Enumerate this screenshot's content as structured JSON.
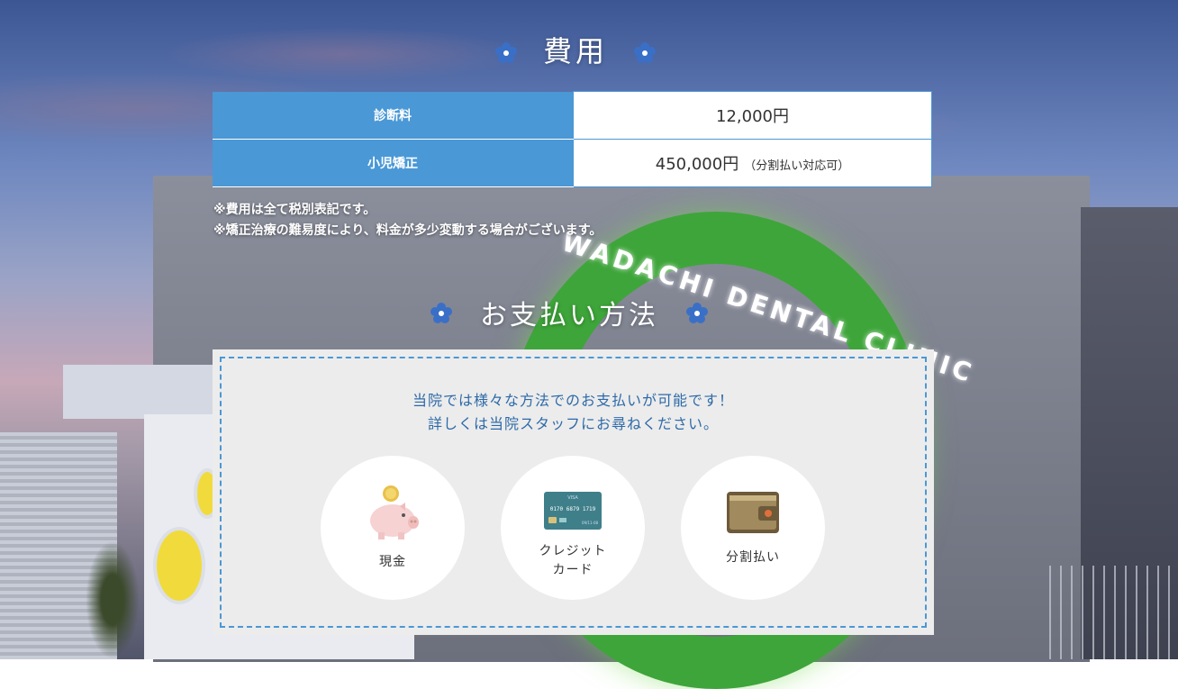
{
  "fees": {
    "title": "費用",
    "rows": [
      {
        "label": "診断料",
        "value": "12,000円",
        "note": ""
      },
      {
        "label": "小児矯正",
        "value": "450,000円",
        "note": "（分割払い対応可）"
      }
    ],
    "notes": [
      "※費用は全て税別表記です。",
      "※矯正治療の難易度により、料金が多少変動する場合がございます。"
    ]
  },
  "payment": {
    "title": "お支払い方法",
    "intro_line1": "当院では様々な方法でのお支払いが可能です！",
    "intro_line2": "詳しくは当院スタッフにお尋ねください。",
    "methods": [
      {
        "icon": "piggy-bank-icon",
        "label": "現金"
      },
      {
        "icon": "credit-card-icon",
        "label_line1": "クレジット",
        "label_line2": "カード",
        "card_brand": "VISA",
        "card_number": "0170 6879 1719",
        "card_expiry": "09/11-08"
      },
      {
        "icon": "wallet-icon",
        "label": "分割払い"
      }
    ]
  },
  "background": {
    "sign_text": "WADACHI DENTAL CLINIC"
  },
  "colors": {
    "accent_blue": "#4a98d6",
    "intro_text": "#2e6aa8",
    "panel_bg": "#ececec"
  }
}
